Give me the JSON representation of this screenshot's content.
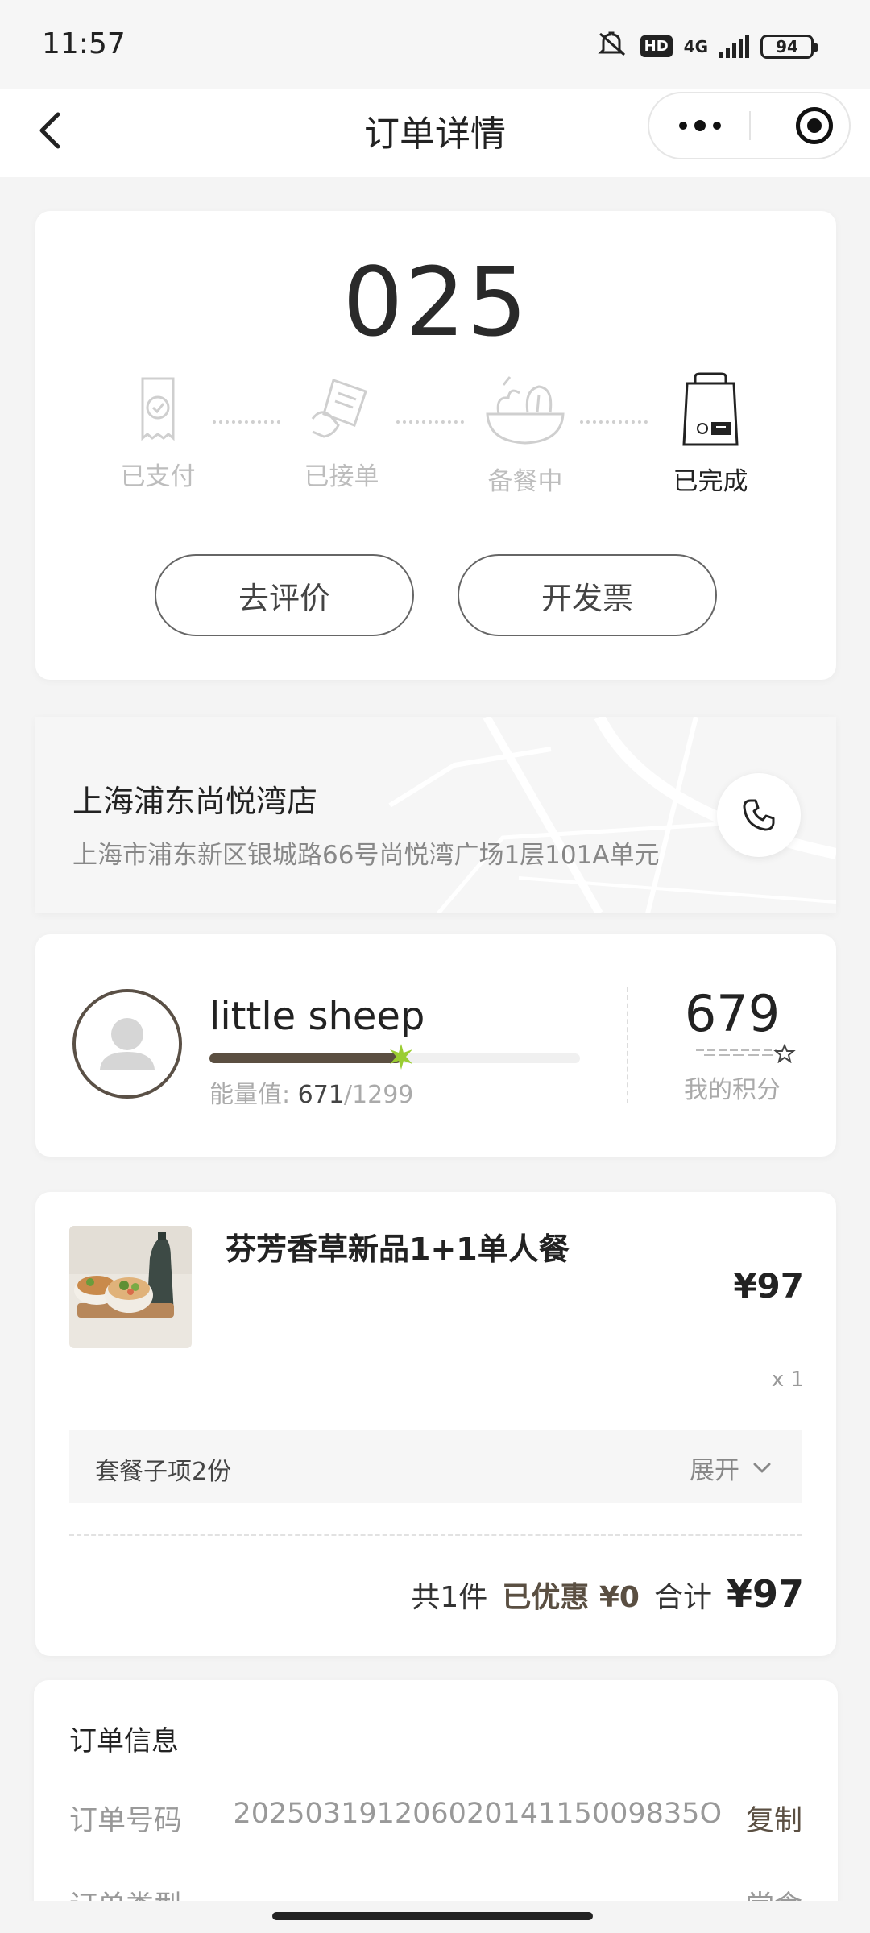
{
  "status_bar": {
    "time": "11:57",
    "network": "4G",
    "hd": "HD",
    "battery": "94"
  },
  "nav": {
    "title": "订单详情"
  },
  "order": {
    "number": "025",
    "steps": [
      {
        "label": "已支付",
        "active": false
      },
      {
        "label": "已接单",
        "active": false
      },
      {
        "label": "备餐中",
        "active": false
      },
      {
        "label": "已完成",
        "active": true
      }
    ],
    "review_button": "去评价",
    "invoice_button": "开发票"
  },
  "store": {
    "name": "上海浦东尚悦湾店",
    "address": "上海市浦东新区银城路66号尚悦湾广场1层101A单元"
  },
  "member": {
    "name": "little sheep",
    "energy_label": "能量值:",
    "energy_current": "671",
    "energy_total": "/1299",
    "energy_progress": 0.517,
    "points": "679",
    "points_label": "我的积分"
  },
  "product": {
    "name": "芬芳香草新品1+1单人餐",
    "price": "¥97",
    "qty": "x 1",
    "sub_items_label": "套餐子项2份",
    "expand_label": "展开"
  },
  "totals": {
    "count": "共1件",
    "discount": "已优惠 ¥0",
    "total_label": "合计",
    "total_amount": "¥97"
  },
  "order_info": {
    "title": "订单信息",
    "order_no_label": "订单号码",
    "order_no": "20250319120602014115009835O",
    "copy": "复制",
    "type_label": "订单类型",
    "type_value": "堂食"
  },
  "colors": {
    "accent": "#5a4f42",
    "star": "#9acd32"
  }
}
